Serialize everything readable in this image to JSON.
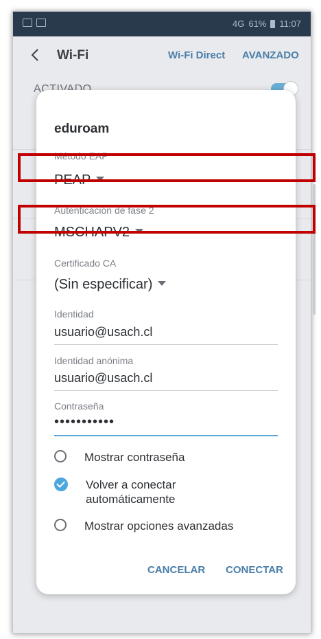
{
  "status_bar": {
    "time": "11:07",
    "battery": "61%",
    "network": "4G"
  },
  "app_bar": {
    "title": "Wi-Fi",
    "wifi_direct": "Wi-Fi Direct",
    "advanced": "AVANZADO"
  },
  "background": {
    "activated_label": "ACTIVADO"
  },
  "dialog": {
    "title": "eduroam",
    "eap_method": {
      "label": "Método EAP",
      "value": "PEAP"
    },
    "phase2": {
      "label": "Autenticación de fase 2",
      "value": "MSCHAPV2"
    },
    "ca_cert": {
      "label": "Certificado CA",
      "value": "(Sin especificar)"
    },
    "identity": {
      "label": "Identidad",
      "value": "usuario@usach.cl"
    },
    "anonymous_identity": {
      "label": "Identidad anónima",
      "value": "usuario@usach.cl"
    },
    "password": {
      "label": "Contraseña",
      "value": "•••••••••••"
    },
    "options": [
      {
        "label": "Mostrar contraseña",
        "checked": false
      },
      {
        "label": "Volver a conectar automáticamente",
        "checked": true
      },
      {
        "label": "Mostrar opciones avanzadas",
        "checked": false
      }
    ],
    "cancel": "CANCELAR",
    "connect": "CONECTAR"
  },
  "colors": {
    "accent": "#4a7ea8",
    "highlight": "#c00000",
    "check": "#4ba7dc"
  },
  "icons": [
    "back-arrow-icon",
    "checkbox-checked-icon",
    "radio-unchecked-icon",
    "dropdown-caret-icon"
  ]
}
